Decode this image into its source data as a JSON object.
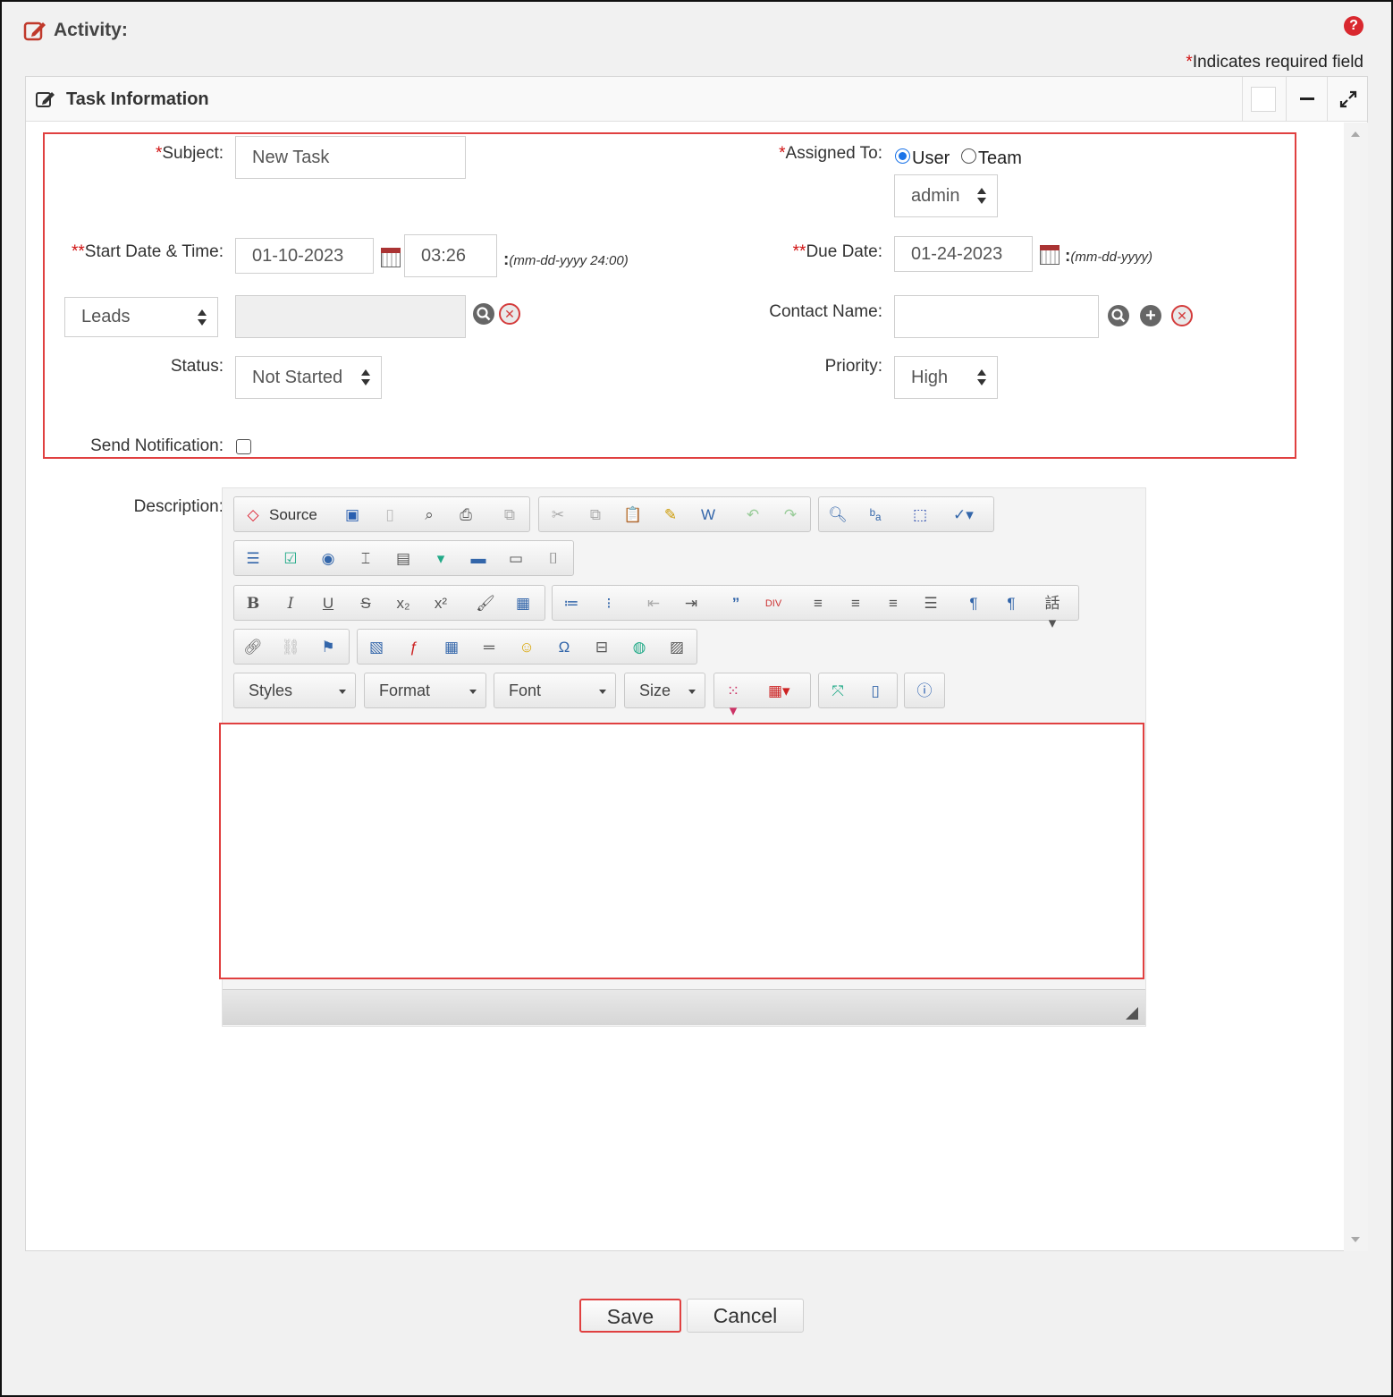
{
  "header": {
    "title": "Activity:",
    "required_star": "*",
    "required_note": "Indicates required field"
  },
  "panel": {
    "title": "Task Information"
  },
  "form": {
    "subject_label": "Subject:",
    "subject_value": "New Task",
    "assigned_label": "Assigned To:",
    "assigned_user": "User",
    "assigned_team": "Team",
    "assigned_select": "admin",
    "start_label": "Start Date & Time:",
    "start_date": "01-10-2023",
    "start_time": "03:26",
    "start_hint": "(mm-dd-yyyy 24:00)",
    "due_label": "Due Date:",
    "due_date": "01-24-2023",
    "due_hint": "(mm-dd-yyyy)",
    "related_select": "Leads",
    "contact_label": "Contact Name:",
    "status_label": "Status:",
    "status_select": "Not Started",
    "priority_label": "Priority:",
    "priority_select": "High",
    "notify_label": "Send Notification:",
    "description_label": "Description:",
    "colon": ":",
    "star": "*",
    "double_star": "**"
  },
  "editor": {
    "source_label": "Source",
    "styles": "Styles",
    "format": "Format",
    "font": "Font",
    "size": "Size"
  },
  "buttons": {
    "save": "Save",
    "cancel": "Cancel"
  },
  "colors": {
    "required": "#d01010",
    "highlight": "#e04040",
    "radio_on": "#1a73e8"
  }
}
